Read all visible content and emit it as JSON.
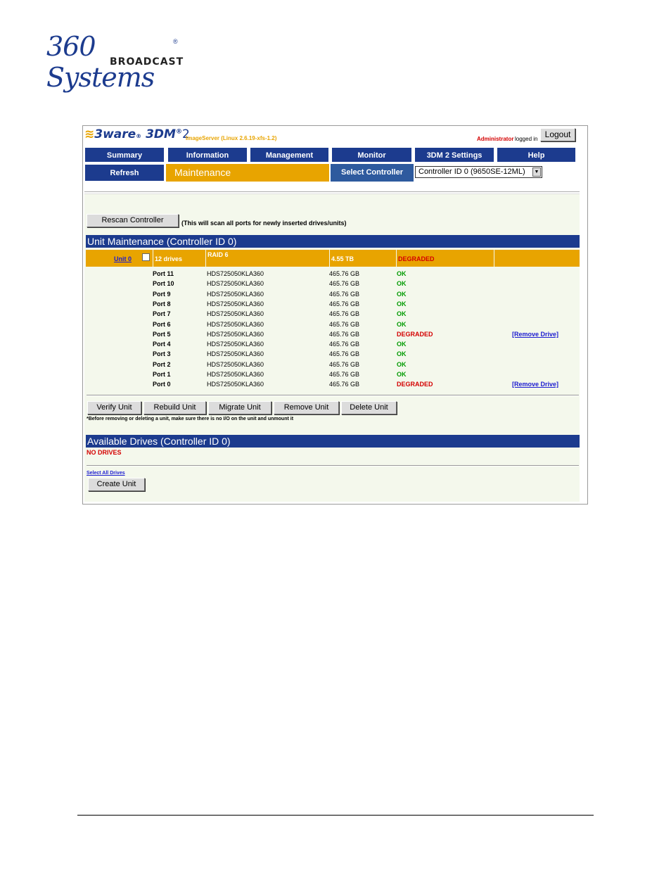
{
  "logo": {
    "script": "360 Systems",
    "sub": "BROADCAST",
    "reg": "®"
  },
  "app": {
    "brand": "3ware",
    "brand_reg": "®",
    "product": "3DM",
    "product_sup": "®",
    "product_ver": "2",
    "server": "ImageServer (Linux 2.6.19-xfs-1.2)",
    "user": "Administrator",
    "logged_in": "logged in",
    "logout": "Logout"
  },
  "nav": {
    "tabs": [
      "Summary",
      "Information",
      "Management",
      "Monitor",
      "3DM 2 Settings",
      "Help"
    ],
    "refresh": "Refresh",
    "current": "Maintenance",
    "select_label": "Select Controller",
    "select_value": "Controller ID 0 (9650SE-12ML)"
  },
  "rescan": {
    "button": "Rescan Controller",
    "note": "(This will scan all ports for newly inserted drives/units)"
  },
  "unit_maint": {
    "title": "Unit Maintenance (Controller ID 0)",
    "unit": {
      "link": "Unit 0",
      "drives": "12 drives",
      "raid": "RAID 6",
      "size": "4.55 TB",
      "status": "DEGRADED"
    },
    "drives": [
      {
        "port": "Port 11",
        "model": "HDS725050KLA360",
        "cap": "465.76 GB",
        "status": "OK",
        "action": ""
      },
      {
        "port": "Port 10",
        "model": "HDS725050KLA360",
        "cap": "465.76 GB",
        "status": "OK",
        "action": ""
      },
      {
        "port": "Port 9",
        "model": "HDS725050KLA360",
        "cap": "465.76 GB",
        "status": "OK",
        "action": ""
      },
      {
        "port": "Port 8",
        "model": "HDS725050KLA360",
        "cap": "465.76 GB",
        "status": "OK",
        "action": ""
      },
      {
        "port": "Port 7",
        "model": "HDS725050KLA360",
        "cap": "465.76 GB",
        "status": "OK",
        "action": ""
      },
      {
        "port": "Port 6",
        "model": "HDS725050KLA360",
        "cap": "465.76 GB",
        "status": "OK",
        "action": ""
      },
      {
        "port": "Port 5",
        "model": "HDS725050KLA360",
        "cap": "465.76 GB",
        "status": "DEGRADED",
        "action": "[Remove Drive]"
      },
      {
        "port": "Port 4",
        "model": "HDS725050KLA360",
        "cap": "465.76 GB",
        "status": "OK",
        "action": ""
      },
      {
        "port": "Port 3",
        "model": "HDS725050KLA360",
        "cap": "465.76 GB",
        "status": "OK",
        "action": ""
      },
      {
        "port": "Port 2",
        "model": "HDS725050KLA360",
        "cap": "465.76 GB",
        "status": "OK",
        "action": ""
      },
      {
        "port": "Port 1",
        "model": "HDS725050KLA360",
        "cap": "465.76 GB",
        "status": "OK",
        "action": ""
      },
      {
        "port": "Port 0",
        "model": "HDS725050KLA360",
        "cap": "465.76 GB",
        "status": "DEGRADED",
        "action": "[Remove Drive]"
      }
    ],
    "actions": [
      "Verify Unit",
      "Rebuild Unit",
      "Migrate Unit",
      "Remove Unit",
      "Delete Unit"
    ],
    "warning": "*Before removing or deleting a unit, make sure there is no I/O on the unit and unmount it"
  },
  "available": {
    "title": "Available Drives (Controller ID 0)",
    "none": "NO DRIVES",
    "select_all": "Select All Drives",
    "create": "Create Unit"
  },
  "colors": {
    "nav_blue": "#1c3b8e",
    "orange": "#e8a400",
    "ok": "#009a00",
    "bad": "#d40000"
  }
}
